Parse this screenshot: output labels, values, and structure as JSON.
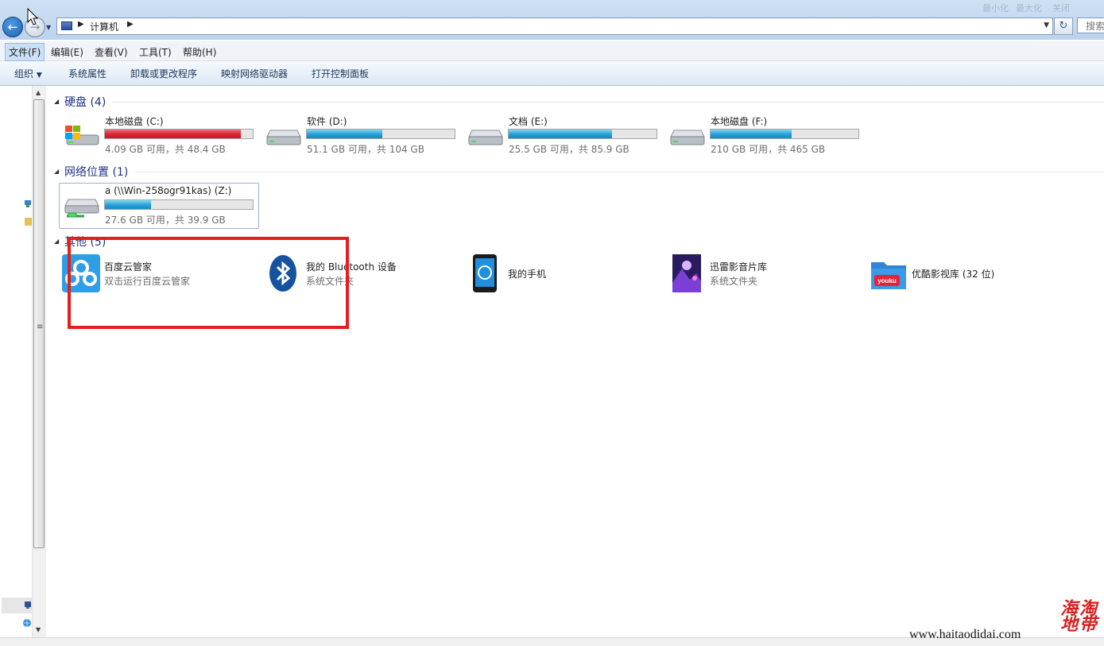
{
  "window": {
    "title": "",
    "controls": [
      "最小化",
      "最大化",
      "关闭"
    ]
  },
  "address": {
    "breadcrumb": [
      "计算机"
    ],
    "search_placeholder": "搜索"
  },
  "menu": [
    {
      "label": "文件(F)",
      "active": true
    },
    {
      "label": "编辑(E)"
    },
    {
      "label": "查看(V)"
    },
    {
      "label": "工具(T)"
    },
    {
      "label": "帮助(H)"
    }
  ],
  "commands": [
    {
      "label": "组织",
      "dropdown": true
    },
    {
      "label": "系统属性"
    },
    {
      "label": "卸载或更改程序"
    },
    {
      "label": "映射网络驱动器"
    },
    {
      "label": "打开控制面板"
    }
  ],
  "groups": {
    "hard_disks": {
      "title": "硬盘 (4)",
      "drives": [
        {
          "name": "本地磁盘 (C:)",
          "free": "4.09 GB 可用，共 48.4 GB",
          "used_fraction": 0.92,
          "color": "#da2636",
          "system": true
        },
        {
          "name": "软件 (D:)",
          "free": "51.1 GB 可用，共 104 GB",
          "used_fraction": 0.51,
          "color": "#26a0da"
        },
        {
          "name": "文档 (E:)",
          "free": "25.5 GB 可用，共 85.9 GB",
          "used_fraction": 0.7,
          "color": "#26a0da"
        },
        {
          "name": "本地磁盘 (F:)",
          "free": "210 GB 可用，共 465 GB",
          "used_fraction": 0.55,
          "color": "#26a0da"
        }
      ]
    },
    "network": {
      "title": "网络位置 (1)",
      "drives": [
        {
          "name": "a (\\\\Win-258ogr91kas) (Z:)",
          "free": "27.6 GB 可用，共 39.9 GB",
          "used_fraction": 0.31,
          "color": "#26a0da"
        }
      ]
    },
    "other": {
      "title": "其他 (5)",
      "items": [
        {
          "name": "百度云管家",
          "sub": "双击运行百度云管家",
          "icon": "baidu-cloud-icon"
        },
        {
          "name": "我的 Bluetooth 设备",
          "sub": "系统文件夹",
          "icon": "bluetooth-icon"
        },
        {
          "name": "我的手机",
          "sub": "",
          "icon": "phone-icon"
        },
        {
          "name": "迅雷影音片库",
          "sub": "系统文件夹",
          "icon": "xunlei-icon"
        },
        {
          "name": "优酷影视库 (32 位)",
          "sub": "",
          "icon": "youku-icon",
          "icon_text": "youku"
        }
      ]
    }
  },
  "watermark": {
    "seal": "海淘地带",
    "url": "www.haitaodidai.com"
  },
  "colors": {
    "accent": "#1e3287",
    "highlight": "#e41e1e",
    "bar_normal": "#26a0da",
    "bar_full": "#da2636"
  }
}
